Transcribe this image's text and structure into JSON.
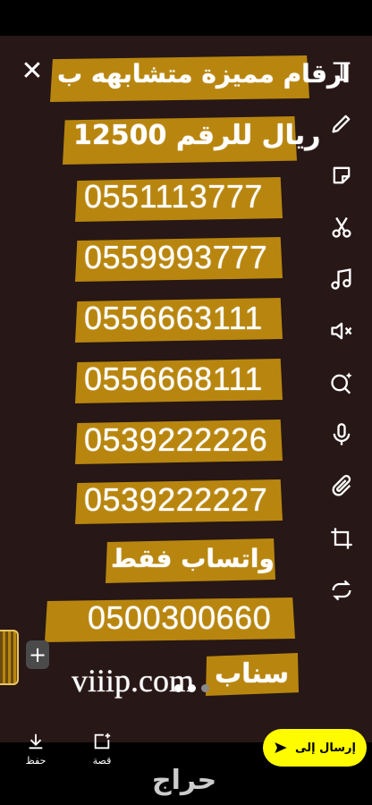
{
  "story": {
    "line1": "ارقام مميزة متشابهه ب",
    "line2": "12500 ريال للرقم",
    "numbers": [
      "0551113777",
      "0559993777",
      "0556663111",
      "0556668111",
      "0539222226",
      "0539222227"
    ],
    "whatsapp_label": "واتساب فقط",
    "whatsapp_number": "0500300660",
    "snap_label": "سناب",
    "website": "viiip.com"
  },
  "toolbar": {
    "icons": [
      "text-icon",
      "pencil-icon",
      "sticker-icon",
      "scissors-icon",
      "music-icon",
      "mute-icon",
      "lens-search-icon",
      "microphone-icon",
      "paperclip-icon",
      "crop-icon",
      "loop-icon"
    ]
  },
  "bottom": {
    "save_label": "حفظ",
    "story_label": "قصة",
    "send_label": "إرسال إلى"
  },
  "watermark": "حراج",
  "colors": {
    "canvas": "#271716",
    "stripe": "#B8860F",
    "send": "#FFFC00"
  }
}
